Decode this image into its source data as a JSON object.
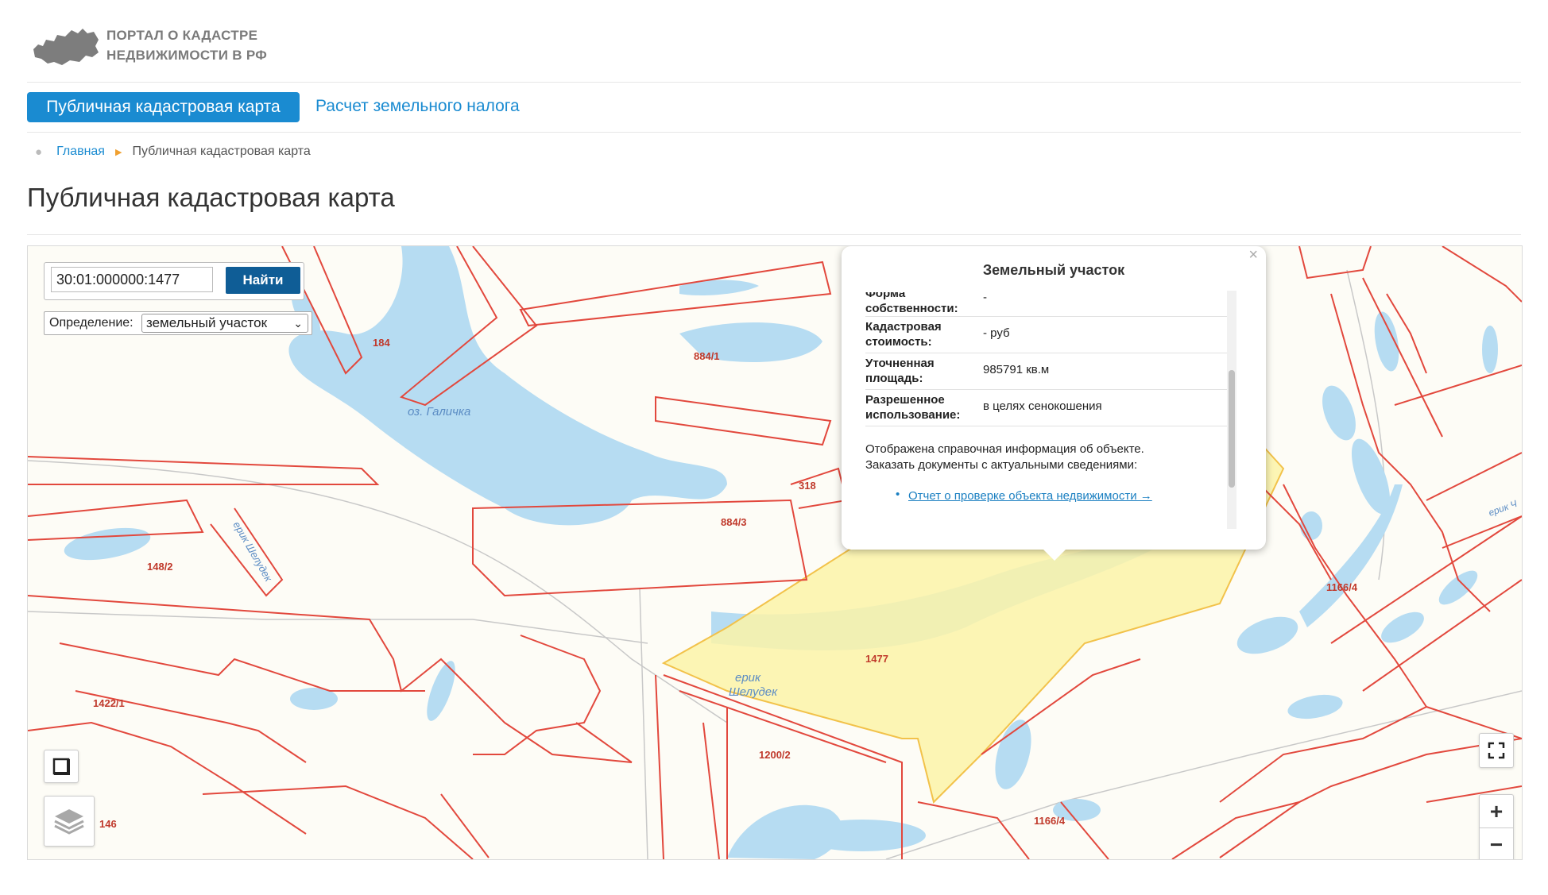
{
  "header": {
    "logo_line1": "ПОРТАЛ О КАДАСТРЕ",
    "logo_line2": "НЕДВИЖИМОСТИ В РФ"
  },
  "nav": {
    "tabs": [
      {
        "label": "Публичная кадастровая карта",
        "active": true
      },
      {
        "label": "Расчет земельного налога",
        "active": false
      }
    ]
  },
  "breadcrumb": {
    "home": "Главная",
    "current": "Публичная кадастровая карта"
  },
  "page_title": "Публичная кадастровая карта",
  "map": {
    "search": {
      "value": "30:01:000000:1477",
      "button": "Найти"
    },
    "definition": {
      "label": "Определение:",
      "selected": "земельный участок"
    },
    "labels": {
      "lake": "оз. Галичка",
      "river1a": "ерик",
      "river1b": "Шелудек",
      "river_side": "ерик Шелудек",
      "river_right": "ерик Ч",
      "p184": "184",
      "p884_1": "884/1",
      "p884_3": "884/3",
      "p318": "318",
      "p148_2": "148/2",
      "p1422_1": "1422/1",
      "p1477": "1477",
      "p1200_2": "1200/2",
      "p1166_4a": "1166/4",
      "p1166_4b": "1166/4",
      "p146": "146"
    },
    "controls": {
      "zoom_in": "+",
      "zoom_out": "−"
    },
    "colors": {
      "parcel_border": "#e2483d",
      "water": "#b6dcf2",
      "selected_fill": "#fbf3a8",
      "selected_border": "#f2c24a",
      "accent": "#1a8bd1"
    }
  },
  "popup": {
    "title": "Земельный участок",
    "close": "×",
    "rows": [
      {
        "key": "Форма собственности:",
        "value": "-"
      },
      {
        "key": "Кадастровая стоимость:",
        "value": "- руб"
      },
      {
        "key": "Уточненная площадь:",
        "value": "985791 кв.м"
      },
      {
        "key": "Разрешенное использование:",
        "value": "в целях сенокошения"
      }
    ],
    "info_line1": "Отображена справочная информация об объекте.",
    "info_line2": "Заказать документы с актуальными сведениями:",
    "link": "Отчет о проверке объекта недвижимости →"
  }
}
